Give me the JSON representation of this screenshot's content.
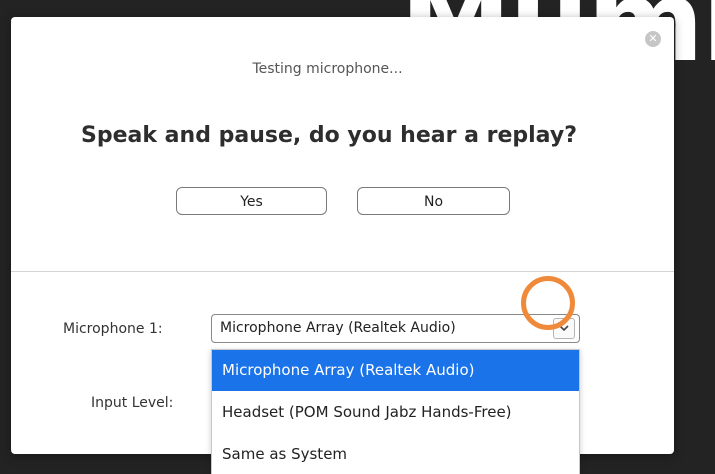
{
  "background": {
    "title_fragment": "Mumie"
  },
  "dialog": {
    "status_text": "Testing microphone...",
    "question": "Speak and pause, do you hear a replay?",
    "yes_label": "Yes",
    "no_label": "No",
    "microphone_label": "Microphone 1:",
    "input_level_label": "Input Level:",
    "selected_microphone": "Microphone Array (Realtek Audio)",
    "close_icon": "close-icon",
    "dropdown_icon": "chevron-down-icon",
    "dropdown_options": [
      {
        "label": "Microphone Array (Realtek Audio)",
        "selected": true
      },
      {
        "label": "Headset (POM Sound Jabz Hands-Free)",
        "selected": false
      },
      {
        "label": "Same as System",
        "selected": false
      }
    ]
  },
  "colors": {
    "accent": "#1a73e8",
    "highlight_ring": "#ef8a3a",
    "background": "#232323"
  }
}
